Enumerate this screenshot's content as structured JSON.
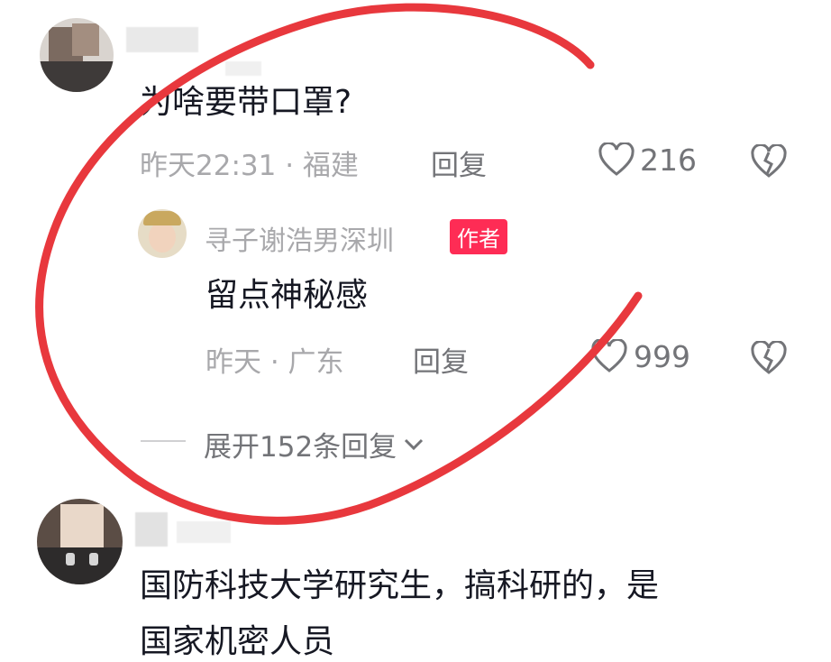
{
  "comment1": {
    "text": "为啥要带口罩?",
    "meta": "昨天22:31 · 福建",
    "reply_label": "回复",
    "like_count": "216"
  },
  "reply1": {
    "username": "寻子谢浩男深圳",
    "badge": "作者",
    "text": "留点神秘感",
    "meta": "昨天 · 广东",
    "reply_label": "回复",
    "like_count": "999"
  },
  "expand": {
    "label": "展开152条回复"
  },
  "comment2": {
    "text_line1": "国防科技大学研究生，搞科研的，是",
    "text_line2": "国家机密人员"
  },
  "colors": {
    "annotation_circle": "#e8383d",
    "author_badge": "#fe2c55"
  },
  "icons": [
    "heart-icon",
    "dislike-broken-heart-icon",
    "chevron-down-icon"
  ]
}
